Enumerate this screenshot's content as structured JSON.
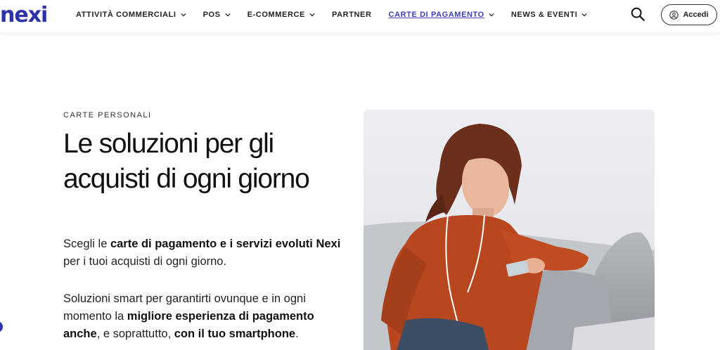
{
  "header": {
    "logo_text": "nexi",
    "nav": [
      {
        "label": "ATTIVITÀ COMMERCIALI",
        "has_dropdown": true,
        "active": false
      },
      {
        "label": "POS",
        "has_dropdown": true,
        "active": false
      },
      {
        "label": "E-COMMERCE",
        "has_dropdown": true,
        "active": false
      },
      {
        "label": "PARTNER",
        "has_dropdown": false,
        "active": false
      },
      {
        "label": "CARTE DI PAGAMENTO",
        "has_dropdown": true,
        "active": true
      },
      {
        "label": "NEWS & EVENTI",
        "has_dropdown": true,
        "active": false
      }
    ],
    "search_icon": "search-icon",
    "login_label": "Accedi",
    "login_icon": "user-circle-icon"
  },
  "hero": {
    "eyebrow": "CARTE PERSONALI",
    "title": "Le soluzioni per gli acquisti di ogni giorno",
    "p1": {
      "t1": "Scegli le ",
      "b1": "carte di pagamento e i servizi evoluti Nexi",
      "t2": " per i tuoi acquisti di ogni giorno."
    },
    "p2": {
      "t1": "Soluzioni smart per garantirti ovunque e in ogni momento la ",
      "b1": "migliore esperienza di pagamento anche",
      "t2": ", e soprattutto, ",
      "b2": "con il tuo smartphone",
      "t3": "."
    }
  },
  "colors": {
    "brand": "#2d32aa",
    "active_nav": "#3b3fb3",
    "text": "#1a1a1a"
  }
}
